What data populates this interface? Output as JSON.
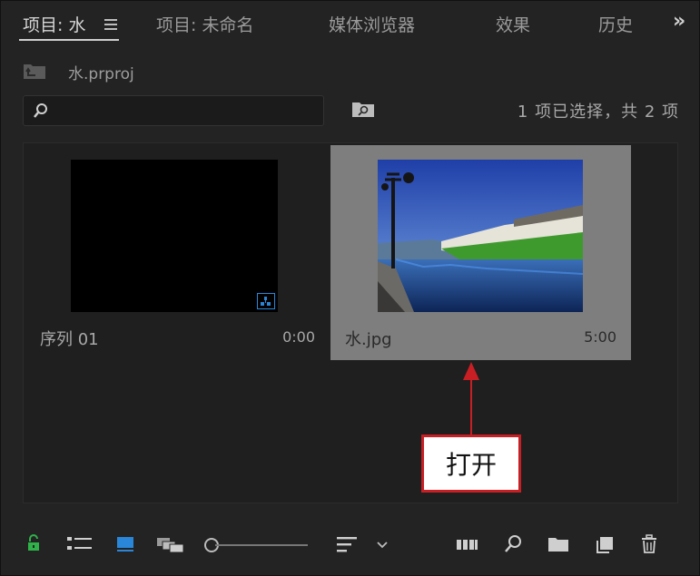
{
  "tabs": [
    {
      "label": "项目: 水",
      "active": true
    },
    {
      "label": "项目: 未命名",
      "active": false
    },
    {
      "label": "媒体浏览器",
      "active": false
    },
    {
      "label": "效果",
      "active": false
    },
    {
      "label": "历史",
      "active": false
    }
  ],
  "overflow_icon": "»",
  "project": {
    "name": "水.prproj"
  },
  "search": {
    "value": "",
    "placeholder": ""
  },
  "status": "1 项已选择，共 2 项",
  "items": [
    {
      "name": "序列 01",
      "duration": "0:00",
      "kind": "sequence"
    },
    {
      "name": "水.jpg",
      "duration": "5:00",
      "kind": "image",
      "selected": true
    }
  ],
  "annotation": {
    "label": "打开",
    "color": "#c71f24"
  },
  "toolbar": {
    "icons": [
      "lock-icon",
      "list-view-icon",
      "icon-view-icon",
      "freeform-view-icon",
      "zoom-slider",
      "sort-icon",
      "chevron-down-icon",
      "automate-to-sequence-icon",
      "find-icon",
      "new-bin-icon",
      "new-item-icon",
      "trash-icon"
    ]
  },
  "colors": {
    "accent_blue": "#2a86d8",
    "lock_green": "#2fb24a",
    "panel_bg": "#232323",
    "selected_item": "#7e7e7e"
  }
}
